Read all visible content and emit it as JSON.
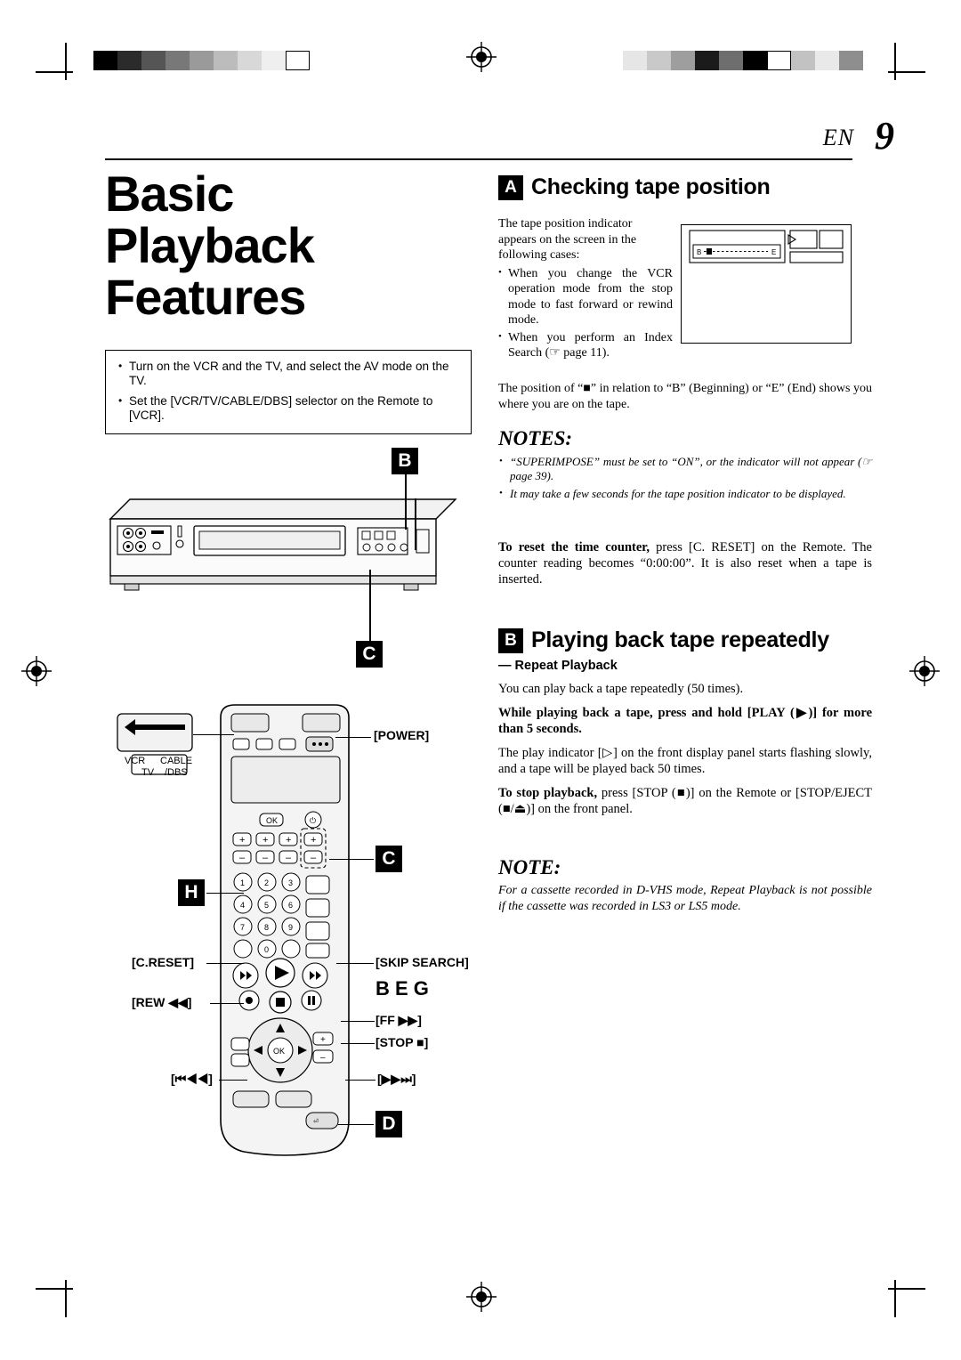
{
  "page": {
    "en_label": "EN",
    "page_number": "9"
  },
  "title": {
    "line1": "Basic",
    "line2": "Playback",
    "line3": "Features"
  },
  "intro_box": {
    "items": [
      "Turn on the VCR and the TV, and select the AV mode on the TV.",
      "Set the [VCR/TV/CABLE/DBS] selector on the Remote to [VCR]."
    ]
  },
  "section_a": {
    "badge": "A",
    "heading": "Checking tape position",
    "intro": "The tape position indicator appears on the screen in the following cases:",
    "bullets": [
      "When you change the VCR operation mode from the stop mode to fast forward or rewind mode.",
      "When you perform an Index Search (☞ page 11)."
    ],
    "closing": "The position of “■” in relation to “B” (Beginning) or “E” (End) shows you where you are on the tape.",
    "screen": {
      "begin_mark": "B",
      "end_mark": "E"
    }
  },
  "notes_block": {
    "heading": "NOTES:",
    "items": [
      "“SUPERIMPOSE” must be set to “ON”, or the indicator will not appear (☞ page 39).",
      "It may take a few seconds for the tape position indicator to be displayed."
    ]
  },
  "reset_para": {
    "bold": "To reset the time counter,",
    "rest": " press [C. RESET] on the Remote. The counter reading becomes “0:00:00”. It is also reset when a tape is inserted."
  },
  "section_b": {
    "badge": "B",
    "heading": "Playing back tape repeatedly",
    "subheading": "— Repeat Playback",
    "para1": "You can play back a tape repeatedly (50 times).",
    "para2_bold": "While playing back a tape, press and hold [PLAY (▶)] for more than 5 seconds.",
    "para3": "The play indicator [▷] on the front display panel starts flashing slowly, and a tape will be played back 50 times.",
    "para4_bold": "To stop playback,",
    "para4_rest": " press [STOP (■)] on the Remote or [STOP/EJECT (■/⏏)] on the front panel.",
    "note_heading": "NOTE:",
    "note_body": "For a cassette recorded in D-VHS mode, Repeat Playback is not possible if the cassette was recorded in LS3 or LS5 mode."
  },
  "callouts": {
    "b_top": "B",
    "c_mid": "C",
    "c_remote": "C",
    "h_remote": "H",
    "beg_row": "B E G",
    "d_remote": "D"
  },
  "remote_labels": {
    "power": "[POWER]",
    "c_reset": "[C.RESET]",
    "skip_search": "[SKIP SEARCH]",
    "rew": "[REW ◀◀]",
    "ff": "[FF ▶▶]",
    "stop": "[STOP ■]",
    "prev": "[⏮◀◀]",
    "next": "[▶▶⏭]",
    "selector_vcr": "VCR",
    "selector_cable": "CABLE",
    "selector_tv": "TV",
    "selector_dbs": "/DBS",
    "keys": [
      "1",
      "2",
      "3",
      "4",
      "5",
      "6",
      "7",
      "8",
      "9",
      "0"
    ],
    "ok": "OK"
  }
}
